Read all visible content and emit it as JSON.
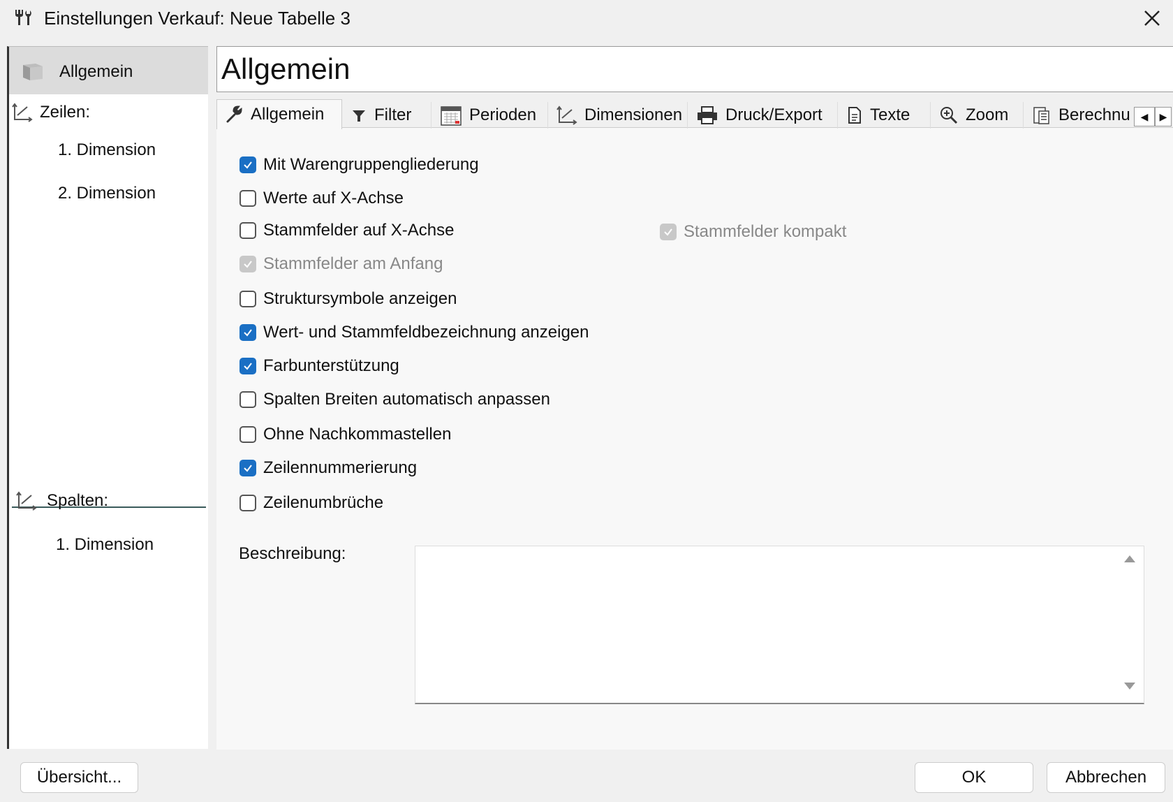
{
  "window": {
    "title": "Einstellungen Verkauf: Neue Tabelle 3",
    "title_icon": "tools-icon",
    "close_icon": "close-icon"
  },
  "sidebar": {
    "header_label": "Allgemein",
    "rows_section": "Zeilen:",
    "rows_items": [
      "1. Dimension",
      "2. Dimension"
    ],
    "columns_section": "Spalten:",
    "columns_items": [
      "1. Dimension"
    ]
  },
  "main": {
    "title": "Allgemein",
    "tabs": [
      {
        "label": "Allgemein",
        "icon": "wrench-icon",
        "active": true
      },
      {
        "label": "Filter",
        "icon": "filter-icon"
      },
      {
        "label": "Perioden",
        "icon": "calendar-icon"
      },
      {
        "label": "Dimensionen",
        "icon": "axes-icon"
      },
      {
        "label": "Druck/Export",
        "icon": "printer-icon"
      },
      {
        "label": "Texte",
        "icon": "document-icon"
      },
      {
        "label": "Zoom",
        "icon": "zoom-icon"
      },
      {
        "label": "Berechnu",
        "icon": "calculator-icon"
      }
    ],
    "options": [
      {
        "label": "Mit Warengruppengliederung",
        "checked": true,
        "disabled": false
      },
      {
        "label": "Werte auf X-Achse",
        "checked": false,
        "disabled": false
      },
      {
        "label": "Stammfelder auf X-Achse",
        "checked": false,
        "disabled": false
      },
      {
        "label": "Stammfelder am Anfang",
        "checked": true,
        "disabled": true
      },
      {
        "label": "Struktursymbole anzeigen",
        "checked": false,
        "disabled": false
      },
      {
        "label": "Wert- und Stammfeldbezeichnung anzeigen",
        "checked": true,
        "disabled": false
      },
      {
        "label": "Farbunterstützung",
        "checked": true,
        "disabled": false
      },
      {
        "label": "Spalten Breiten automatisch anpassen",
        "checked": false,
        "disabled": false
      },
      {
        "label": "Ohne Nachkommastellen",
        "checked": false,
        "disabled": false
      },
      {
        "label": "Zeilennummerierung",
        "checked": true,
        "disabled": false
      },
      {
        "label": "Zeilenumbrüche",
        "checked": false,
        "disabled": false
      }
    ],
    "option_side": {
      "label": "Stammfelder kompakt",
      "checked": true,
      "disabled": true
    },
    "description_label": "Beschreibung:",
    "description_value": ""
  },
  "footer": {
    "overview_button": "Übersicht...",
    "ok_button": "OK",
    "cancel_button": "Abbrechen"
  },
  "colors": {
    "checkbox_checked": "#1a6fc4",
    "checkbox_disabled": "#c8c8c8"
  }
}
